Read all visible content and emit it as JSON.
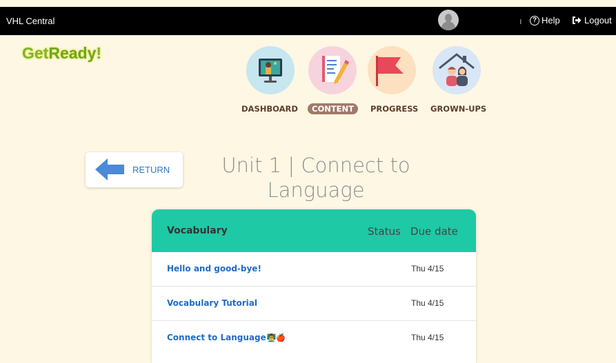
{
  "topbar": {
    "brand": "VHL Central",
    "separator": "ı",
    "help_label": "Help",
    "logout_label": "Logout"
  },
  "logo": {
    "part1": "Get",
    "part2": "Ready",
    "part3": "!"
  },
  "nav": {
    "items": [
      {
        "label": "DASHBOARD",
        "icon": "teacher-screen-icon",
        "bg": "#c6e6f0"
      },
      {
        "label": "CONTENT",
        "icon": "notepad-pencil-icon",
        "bg": "#f7d3dd",
        "active": true
      },
      {
        "label": "PROGRESS",
        "icon": "flag-icon",
        "bg": "#fde0c0"
      },
      {
        "label": "GROWN-UPS",
        "icon": "family-house-icon",
        "bg": "#d8e6f5"
      }
    ]
  },
  "return_button": {
    "label": "RETURN"
  },
  "unit_title": "Unit 1 | Connect to Language",
  "table": {
    "title": "Vocabulary",
    "status_header": "Status",
    "due_header": "Due date",
    "rows": [
      {
        "name": "Hello and good-bye!",
        "due": "Thu 4/15"
      },
      {
        "name": "Vocabulary Tutorial",
        "due": "Thu 4/15"
      },
      {
        "name": "Connect to Language",
        "due": "Thu 4/15",
        "extra": "👨‍🏫🍎"
      }
    ]
  },
  "colors": {
    "accent": "#1ec9a6",
    "link": "#1f6bc7",
    "background": "#fdf7e4"
  }
}
